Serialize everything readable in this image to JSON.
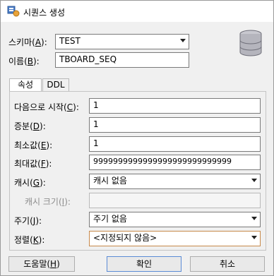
{
  "window": {
    "title": "시퀀스 생성"
  },
  "top": {
    "schema": {
      "label_pre": "스키마(",
      "mnemonic": "A",
      "label_post": "):",
      "value": "TEST"
    },
    "name": {
      "label_pre": "이름(",
      "mnemonic": "B",
      "label_post": "):",
      "value": "TBOARD_SEQ"
    }
  },
  "tabs": [
    {
      "label": "속성",
      "active": true
    },
    {
      "label": "DDL",
      "active": false
    }
  ],
  "form": {
    "start": {
      "label_pre": "다음으로 시작(",
      "mnemonic": "C",
      "label_post": "):",
      "value": "1"
    },
    "increment": {
      "label_pre": "증분(",
      "mnemonic": "D",
      "label_post": "):",
      "value": "1"
    },
    "minvalue": {
      "label_pre": "최소값(",
      "mnemonic": "E",
      "label_post": "):",
      "value": "1"
    },
    "maxvalue": {
      "label_pre": "최대값(",
      "mnemonic": "F",
      "label_post": "):",
      "value": "9999999999999999999999999999"
    },
    "cache": {
      "label_pre": "캐시(",
      "mnemonic": "G",
      "label_post": "):",
      "value": "캐시 없음"
    },
    "cache_size": {
      "label_pre": "캐시 크기(",
      "mnemonic": "I",
      "label_post": "):",
      "value": ""
    },
    "cycle": {
      "label_pre": "주기(",
      "mnemonic": "J",
      "label_post": "):",
      "value": "주기 없음"
    },
    "order": {
      "label_pre": "정렬(",
      "mnemonic": "K",
      "label_post": "):",
      "value": "<지정되지 않음>"
    }
  },
  "buttons": {
    "help": {
      "label_pre": "도움말(",
      "mnemonic": "H",
      "label_post": ")"
    },
    "ok": {
      "label": "확인"
    },
    "cancel": {
      "label": "취소"
    }
  },
  "colors": {
    "focus_border": "#c7894a",
    "default_button_border": "#5a8bd6"
  }
}
